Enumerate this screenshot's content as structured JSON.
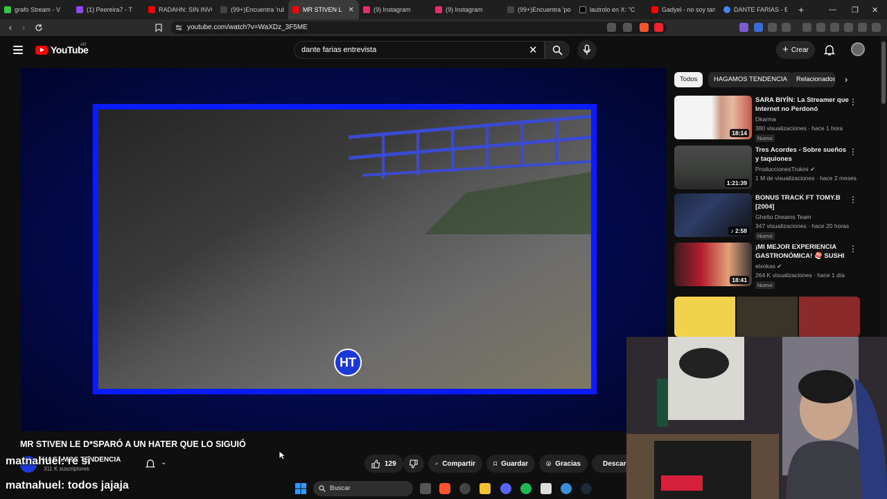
{
  "browser": {
    "tabs": [
      {
        "title": "grafo Stream - V",
        "color": "#2ecc40",
        "active": false
      },
      {
        "title": "(1) Peereira7 - T",
        "color": "#9146ff",
        "active": false
      },
      {
        "title": "RADAHN: SIN INVO",
        "color": "#ff0000",
        "active": false
      },
      {
        "title": "(99+)Encuentra 'rub",
        "color": "#222222",
        "active": false
      },
      {
        "title": "MR STIVEN L",
        "color": "#ff0000",
        "active": true
      },
      {
        "title": "(9) Instagram",
        "color": "#e1306c",
        "active": false
      },
      {
        "title": "(9) Instagram",
        "color": "#e1306c",
        "active": false
      },
      {
        "title": "(99+)Encuentra 'pol",
        "color": "#222222",
        "active": false
      },
      {
        "title": "lautrolo en X: \"C",
        "color": "#000000",
        "active": false
      },
      {
        "title": "Gadyel - no soy tan",
        "color": "#ff0000",
        "active": false
      },
      {
        "title": "DANTE FARIAS - Bu",
        "color": "#4285f4",
        "active": false
      }
    ],
    "new_tab": "+",
    "url": "youtube.com/watch?v=WaXDz_3F5ME",
    "window_controls": {
      "minimize": "—",
      "restore": "❐",
      "close": "✕"
    }
  },
  "youtube": {
    "logo_text": "YouTube",
    "country": "AR",
    "search_query": "dante farias entrevista",
    "create_label": "Crear",
    "video": {
      "title": "MR STIVEN LE D*SPARÓ A UN HATER QUE LO SIGUIÓ",
      "channel_name": "HAGAMOS TENDENCIA",
      "subscribers": "311 K suscriptores",
      "badge_text": "HT",
      "likes": "129",
      "share_label": "Compartir",
      "save_label": "Guardar",
      "thanks_label": "Gracias",
      "download_label": "Descargar"
    },
    "chips": [
      {
        "label": "Todos",
        "selected": true
      },
      {
        "label": "HAGAMOS TENDENCIA",
        "selected": false
      },
      {
        "label": "Relacionados",
        "selected": false
      }
    ],
    "recommendations": [
      {
        "title": "SARA BIYÍN: La Streamer que Internet no Perdonó",
        "channel": "Dkarma",
        "meta": "380 visualizaciones · hace 1 hora",
        "duration": "18:14",
        "badge": "Nuevo",
        "verified": false
      },
      {
        "title": "Tres Acordes - Sobre sueños y taquiones",
        "channel": "ProduccionesTrukini",
        "meta": "1 M de visualizaciones · hace 2 meses",
        "duration": "1:21:39",
        "badge": "",
        "verified": true
      },
      {
        "title": "BONUS TRACK FT TOMY.B [2004]",
        "channel": "Ghetto Dreams Team",
        "meta": "347 visualizaciones · hace 20 horas",
        "duration": "2:58",
        "badge": "Nuevo",
        "verified": false
      },
      {
        "title": "¡MI MEJOR EXPERIENCIA GASTRONÓMICA! 🍣 SUSHI ...",
        "channel": "elxokas",
        "meta": "264 K visualizaciones · hace 1 día",
        "duration": "18:41",
        "badge": "Nuevo",
        "verified": true
      }
    ]
  },
  "stream_overlay": {
    "chat": [
      {
        "user": "matnahuel",
        "message": "re si"
      },
      {
        "user": "matnahuel",
        "message": "todos jajaja"
      }
    ]
  },
  "taskbar": {
    "search_placeholder": "Buscar"
  },
  "colors": {
    "youtube_red": "#ff0000",
    "frame_blue": "#0a1cff",
    "player_bg": "#030a4c"
  }
}
